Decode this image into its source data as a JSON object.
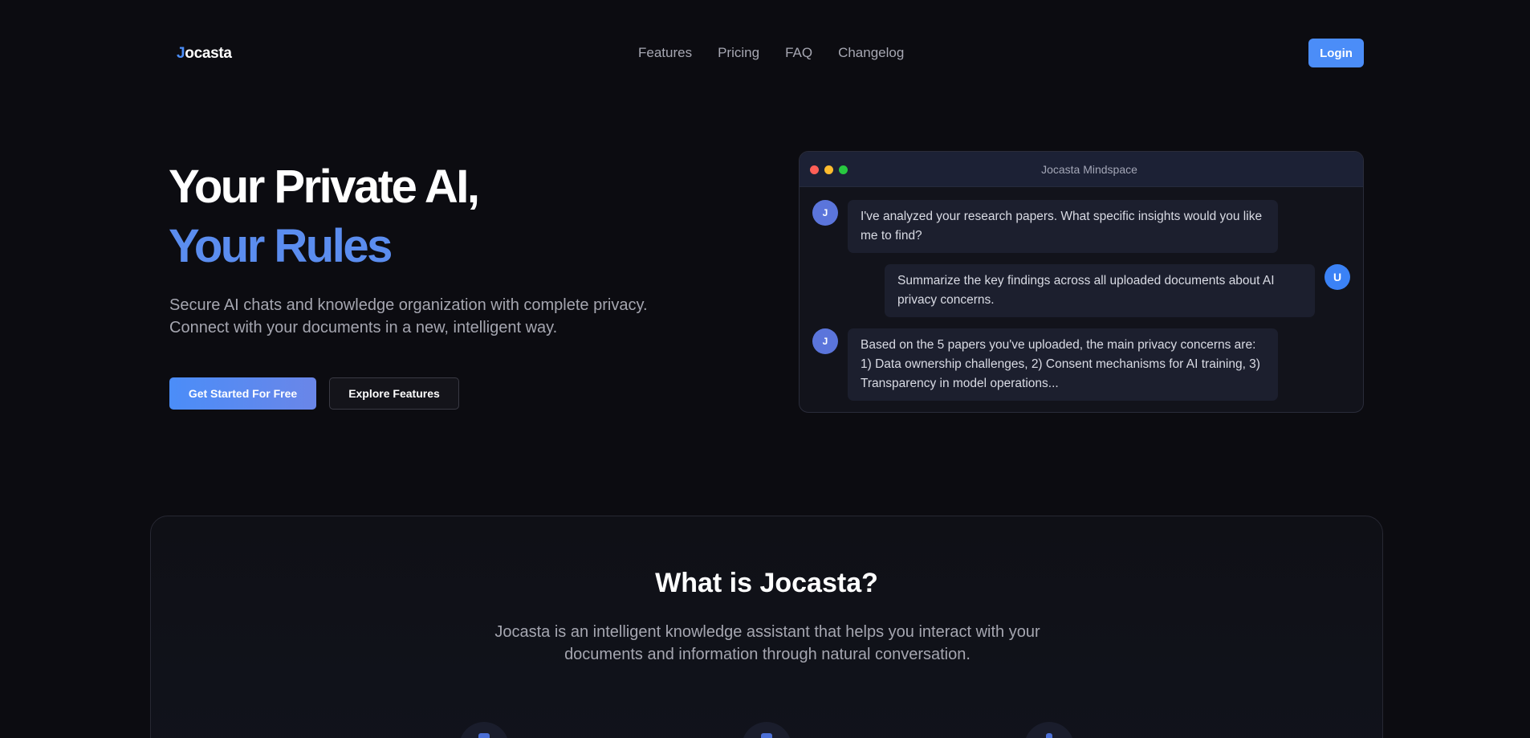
{
  "nav": {
    "logo_first": "J",
    "logo_rest": "ocasta",
    "links": [
      "Features",
      "Pricing",
      "FAQ",
      "Changelog"
    ],
    "login_label": "Login"
  },
  "hero": {
    "title_line1": "Your Private AI,",
    "title_line2": "Your Rules",
    "subtitle_line1": "Secure AI chats and knowledge organization with complete privacy.",
    "subtitle_line2": "Connect with your documents in a new, intelligent way.",
    "primary_button": "Get Started For Free",
    "secondary_button": "Explore Features"
  },
  "chat": {
    "window_title": "Jocasta Mindspace",
    "messages": [
      {
        "role": "ai",
        "avatar": "J",
        "text": "I've analyzed your research papers. What specific insights would you like me to find?"
      },
      {
        "role": "user",
        "avatar": "U",
        "text": "Summarize the key findings across all uploaded documents about AI privacy concerns."
      },
      {
        "role": "ai",
        "avatar": "J",
        "text": "Based on the 5 papers you've uploaded, the main privacy concerns are: 1) Data ownership challenges, 2) Consent mechanisms for AI training, 3) Transparency in model operations..."
      }
    ]
  },
  "about": {
    "title": "What is Jocasta?",
    "description_line1": "Jocasta is an intelligent knowledge assistant that helps you interact with your",
    "description_line2": "documents and information through natural conversation."
  },
  "colors": {
    "accent": "#4b8df8",
    "background": "#0c0c11",
    "title_accent": "#5b8def"
  }
}
